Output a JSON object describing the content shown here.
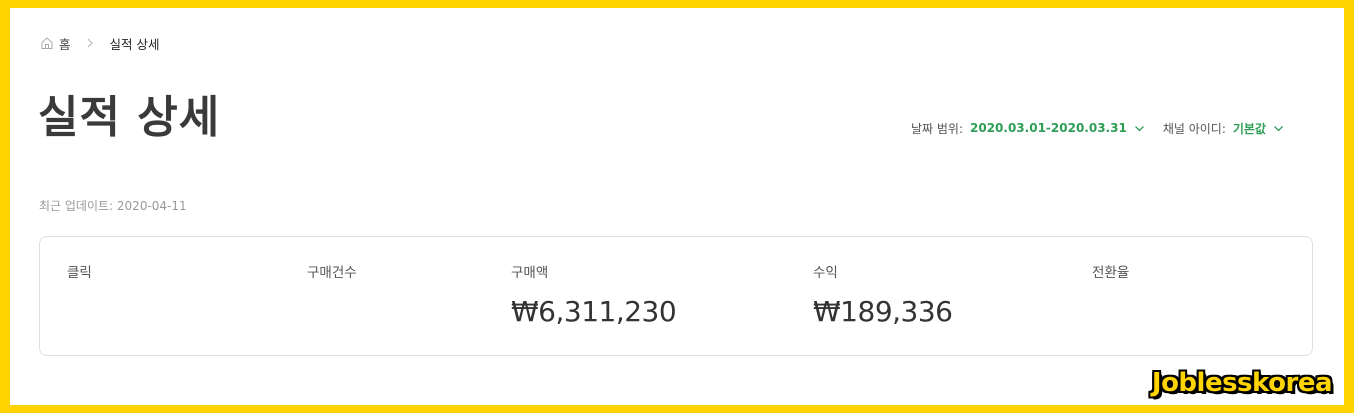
{
  "breadcrumb": {
    "home_label": "홈",
    "current_label": "실적 상세"
  },
  "page": {
    "title": "실적 상세",
    "last_updated": "최근 업데이트: 2020-04-11"
  },
  "filters": {
    "date_range_label": "날짜 범위:",
    "date_range_value": "2020.03.01-2020.03.31",
    "channel_id_label": "채널 아이디:",
    "channel_id_value": "기본값"
  },
  "stats": [
    {
      "label": "클릭",
      "value": ""
    },
    {
      "label": "구매건수",
      "value": ""
    },
    {
      "label": "구매액",
      "value": "₩6,311,230"
    },
    {
      "label": "수익",
      "value": "₩189,336"
    },
    {
      "label": "전환율",
      "value": ""
    }
  ],
  "watermark": "Joblesskorea",
  "colors": {
    "background": "#ffd400",
    "accent": "#2e9e57",
    "text": "#333333"
  },
  "icons": {
    "home": "home-icon",
    "breadcrumb_separator": "chevron-right-icon",
    "dropdown": "chevron-down-icon"
  }
}
